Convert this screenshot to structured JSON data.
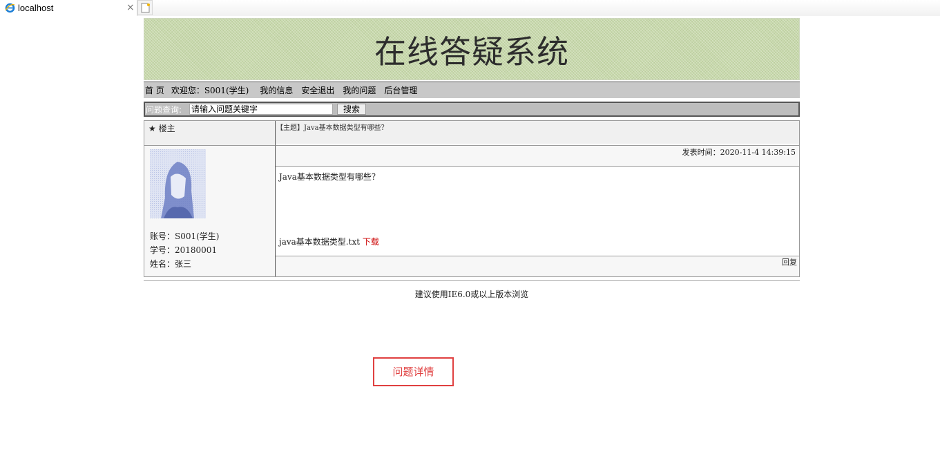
{
  "browser": {
    "tab_title": "localhost",
    "close_glyph": "×",
    "icons": {
      "tab": "ie-logo-icon",
      "close": "close-icon",
      "new_tab": "new-tab-icon"
    }
  },
  "site": {
    "title": "在线答疑系统",
    "nav": {
      "home": "首 页",
      "welcome": "欢迎您：S001(学生)",
      "my_info": "我的信息",
      "logout": "安全退出",
      "my_questions": "我的问题",
      "admin": "后台管理"
    },
    "search": {
      "label": "问题查询:",
      "placeholder": "请输入问题关键字",
      "button": "搜索"
    }
  },
  "post": {
    "floor_label": "★ 楼主",
    "subject": "【主题】Java基本数据类型有哪些？",
    "time": "发表时间：2020-11-4 14:39:15",
    "content": "Java基本数据类型有哪些？",
    "attachment_name": "java基本数据类型.txt",
    "download_label": "下载",
    "reply_label": "回复",
    "author": {
      "account": "账号：S001(学生)",
      "student_no": "学号：20180001",
      "name": "姓名：张三"
    }
  },
  "footer": {
    "text": "建议使用IE6.0或以上版本浏览"
  },
  "annotation": {
    "label": "问题详情"
  },
  "colors": {
    "accent": "#e04040",
    "download": "#cc0000",
    "banner": "#c8d9ac",
    "nav": "#c8c8c8"
  }
}
